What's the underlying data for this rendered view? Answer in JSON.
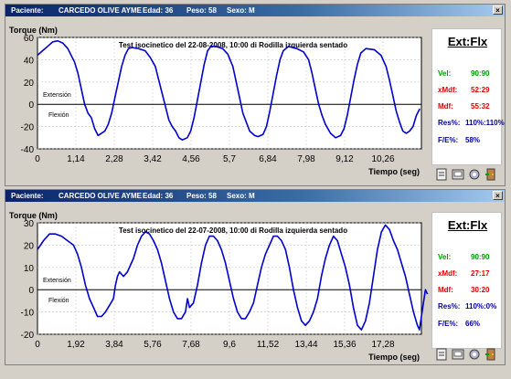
{
  "windows": [
    {
      "titlebar": {
        "paciente_label": "Paciente:",
        "paciente_name": "CARCEDO OLIVE AYME",
        "edad": "Edad: 36",
        "peso": "Peso: 58",
        "sexo": "Sexo: M"
      },
      "close_glyph": "×",
      "side": {
        "header": "Ext:Flx",
        "rows": [
          {
            "label": "Vel:",
            "value": "90:90",
            "color": "#009900"
          },
          {
            "label": "xMdf:",
            "value": "52:29",
            "color": "#e00000"
          },
          {
            "label": "Mdf:",
            "value": "55:32",
            "color": "#e00000"
          },
          {
            "label": "Res%:",
            "value": "110%:110%",
            "color": "#000099"
          },
          {
            "label": "F/E%:",
            "value": "58%",
            "color": "#000099"
          }
        ]
      },
      "chart_data": {
        "type": "line",
        "title": "Test isocinetico del 22-08-2008, 10:00 di Rodilla izquierda sentado",
        "ylabel": "Torque (Nm)",
        "xlabel": "Tiempo (seg)",
        "region_labels": [
          "Extensión",
          "Flexión"
        ],
        "ylim": [
          -40,
          60
        ],
        "yticks": [
          -40,
          -20,
          0,
          20,
          40,
          60
        ],
        "xlim": [
          0,
          11.4
        ],
        "xticks": [
          "0",
          "1,14",
          "2,28",
          "3,42",
          "4,56",
          "5,7",
          "6,84",
          "7,98",
          "9,12",
          "10,26"
        ],
        "series": [
          {
            "color": "#0000cc",
            "points": [
              [
                0,
                44
              ],
              [
                0.15,
                48
              ],
              [
                0.3,
                52
              ],
              [
                0.45,
                56
              ],
              [
                0.6,
                57
              ],
              [
                0.75,
                55
              ],
              [
                0.9,
                50
              ],
              [
                1.0,
                44
              ],
              [
                1.1,
                38
              ],
              [
                1.2,
                28
              ],
              [
                1.3,
                14
              ],
              [
                1.4,
                0
              ],
              [
                1.5,
                -8
              ],
              [
                1.6,
                -12
              ],
              [
                1.7,
                -22
              ],
              [
                1.8,
                -28
              ],
              [
                1.9,
                -26
              ],
              [
                2.0,
                -24
              ],
              [
                2.1,
                -18
              ],
              [
                2.2,
                -8
              ],
              [
                2.3,
                6
              ],
              [
                2.4,
                20
              ],
              [
                2.5,
                34
              ],
              [
                2.6,
                44
              ],
              [
                2.7,
                50
              ],
              [
                2.8,
                51
              ],
              [
                3.0,
                50
              ],
              [
                3.2,
                48
              ],
              [
                3.35,
                42
              ],
              [
                3.5,
                34
              ],
              [
                3.6,
                22
              ],
              [
                3.7,
                10
              ],
              [
                3.8,
                -2
              ],
              [
                3.9,
                -14
              ],
              [
                4.0,
                -20
              ],
              [
                4.1,
                -24
              ],
              [
                4.2,
                -30
              ],
              [
                4.3,
                -32
              ],
              [
                4.45,
                -30
              ],
              [
                4.55,
                -24
              ],
              [
                4.65,
                -12
              ],
              [
                4.75,
                4
              ],
              [
                4.85,
                20
              ],
              [
                4.95,
                36
              ],
              [
                5.05,
                48
              ],
              [
                5.15,
                52
              ],
              [
                5.3,
                52
              ],
              [
                5.5,
                50
              ],
              [
                5.65,
                45
              ],
              [
                5.8,
                34
              ],
              [
                5.9,
                20
              ],
              [
                6.0,
                6
              ],
              [
                6.1,
                -8
              ],
              [
                6.2,
                -16
              ],
              [
                6.3,
                -24
              ],
              [
                6.45,
                -28
              ],
              [
                6.55,
                -29
              ],
              [
                6.7,
                -27
              ],
              [
                6.8,
                -20
              ],
              [
                6.9,
                -6
              ],
              [
                7.0,
                10
              ],
              [
                7.1,
                26
              ],
              [
                7.2,
                40
              ],
              [
                7.3,
                48
              ],
              [
                7.45,
                52
              ],
              [
                7.7,
                50
              ],
              [
                7.9,
                47
              ],
              [
                8.05,
                40
              ],
              [
                8.15,
                28
              ],
              [
                8.25,
                14
              ],
              [
                8.35,
                0
              ],
              [
                8.45,
                -10
              ],
              [
                8.55,
                -18
              ],
              [
                8.7,
                -26
              ],
              [
                8.85,
                -30
              ],
              [
                9.0,
                -28
              ],
              [
                9.1,
                -22
              ],
              [
                9.2,
                -10
              ],
              [
                9.3,
                6
              ],
              [
                9.4,
                22
              ],
              [
                9.5,
                36
              ],
              [
                9.6,
                46
              ],
              [
                9.75,
                50
              ],
              [
                10.0,
                49
              ],
              [
                10.2,
                44
              ],
              [
                10.35,
                34
              ],
              [
                10.45,
                22
              ],
              [
                10.55,
                8
              ],
              [
                10.65,
                -6
              ],
              [
                10.75,
                -16
              ],
              [
                10.85,
                -24
              ],
              [
                10.95,
                -26
              ],
              [
                11.05,
                -24
              ],
              [
                11.15,
                -20
              ],
              [
                11.25,
                -10
              ],
              [
                11.35,
                -4
              ]
            ]
          }
        ]
      }
    },
    {
      "titlebar": {
        "paciente_label": "Paciente:",
        "paciente_name": "CARCEDO OLIVE AYME",
        "edad": "Edad: 36",
        "peso": "Peso: 58",
        "sexo": "Sexo: M"
      },
      "close_glyph": "×",
      "side": {
        "header": "Ext:Flx",
        "rows": [
          {
            "label": "Vel:",
            "value": "90:90",
            "color": "#009900"
          },
          {
            "label": "xMdf:",
            "value": "27:17",
            "color": "#e00000"
          },
          {
            "label": "Mdf:",
            "value": "30:20",
            "color": "#e00000"
          },
          {
            "label": "Res%:",
            "value": "110%:0%",
            "color": "#000099"
          },
          {
            "label": "F/E%:",
            "value": "66%",
            "color": "#000099"
          }
        ]
      },
      "chart_data": {
        "type": "line",
        "title": "Test isocinetico del 22-07-2008, 10:00 di Rodilla izquierda sentado",
        "ylabel": "Torque (Nm)",
        "xlabel": "Tiempo (seg)",
        "region_labels": [
          "Extensión",
          "Flexión"
        ],
        "ylim": [
          -20,
          30
        ],
        "yticks": [
          -20,
          -10,
          0,
          10,
          20,
          30
        ],
        "xlim": [
          0,
          19.2
        ],
        "xticks": [
          "0",
          "1,92",
          "3,84",
          "5,76",
          "7,68",
          "9,6",
          "11,52",
          "13,44",
          "15,36",
          "17,28"
        ],
        "series": [
          {
            "color": "#0000cc",
            "points": [
              [
                0,
                18
              ],
              [
                0.3,
                22
              ],
              [
                0.6,
                25
              ],
              [
                0.9,
                25
              ],
              [
                1.2,
                24
              ],
              [
                1.5,
                22
              ],
              [
                1.8,
                20
              ],
              [
                2.0,
                16
              ],
              [
                2.2,
                10
              ],
              [
                2.4,
                2
              ],
              [
                2.6,
                -4
              ],
              [
                2.8,
                -8
              ],
              [
                3.0,
                -12
              ],
              [
                3.2,
                -12
              ],
              [
                3.4,
                -10
              ],
              [
                3.6,
                -7
              ],
              [
                3.8,
                -4
              ],
              [
                3.9,
                2
              ],
              [
                4.0,
                6
              ],
              [
                4.1,
                8
              ],
              [
                4.3,
                6
              ],
              [
                4.5,
                8
              ],
              [
                4.8,
                14
              ],
              [
                5.0,
                20
              ],
              [
                5.2,
                24
              ],
              [
                5.4,
                26
              ],
              [
                5.6,
                25
              ],
              [
                5.8,
                22
              ],
              [
                6.0,
                18
              ],
              [
                6.2,
                12
              ],
              [
                6.4,
                4
              ],
              [
                6.6,
                -4
              ],
              [
                6.8,
                -10
              ],
              [
                7.0,
                -13
              ],
              [
                7.2,
                -13
              ],
              [
                7.4,
                -10
              ],
              [
                7.5,
                -4
              ],
              [
                7.6,
                -8
              ],
              [
                7.8,
                -6
              ],
              [
                8.0,
                2
              ],
              [
                8.2,
                12
              ],
              [
                8.4,
                20
              ],
              [
                8.6,
                24
              ],
              [
                8.8,
                24
              ],
              [
                9.0,
                22
              ],
              [
                9.2,
                18
              ],
              [
                9.4,
                12
              ],
              [
                9.6,
                4
              ],
              [
                9.8,
                -4
              ],
              [
                10.0,
                -10
              ],
              [
                10.2,
                -13
              ],
              [
                10.4,
                -13
              ],
              [
                10.6,
                -10
              ],
              [
                10.8,
                -6
              ],
              [
                11.0,
                2
              ],
              [
                11.2,
                10
              ],
              [
                11.4,
                16
              ],
              [
                11.6,
                20
              ],
              [
                11.8,
                24
              ],
              [
                12.0,
                24
              ],
              [
                12.2,
                22
              ],
              [
                12.4,
                18
              ],
              [
                12.6,
                10
              ],
              [
                12.8,
                0
              ],
              [
                13.0,
                -8
              ],
              [
                13.2,
                -14
              ],
              [
                13.4,
                -16
              ],
              [
                13.6,
                -14
              ],
              [
                13.8,
                -10
              ],
              [
                14.0,
                -4
              ],
              [
                14.2,
                6
              ],
              [
                14.4,
                14
              ],
              [
                14.6,
                20
              ],
              [
                14.8,
                24
              ],
              [
                15.0,
                22
              ],
              [
                15.2,
                16
              ],
              [
                15.4,
                10
              ],
              [
                15.6,
                2
              ],
              [
                15.8,
                -8
              ],
              [
                16.0,
                -16
              ],
              [
                16.2,
                -18
              ],
              [
                16.4,
                -14
              ],
              [
                16.6,
                -6
              ],
              [
                16.8,
                6
              ],
              [
                17.0,
                18
              ],
              [
                17.2,
                26
              ],
              [
                17.4,
                29
              ],
              [
                17.6,
                27
              ],
              [
                17.8,
                22
              ],
              [
                18.0,
                18
              ],
              [
                18.2,
                12
              ],
              [
                18.4,
                6
              ],
              [
                18.6,
                -2
              ],
              [
                18.8,
                -10
              ],
              [
                19.0,
                -16
              ],
              [
                19.1,
                -18
              ],
              [
                19.2,
                -12
              ],
              [
                19.3,
                -6
              ],
              [
                19.4,
                0
              ],
              [
                19.5,
                -2
              ]
            ]
          }
        ]
      }
    }
  ]
}
